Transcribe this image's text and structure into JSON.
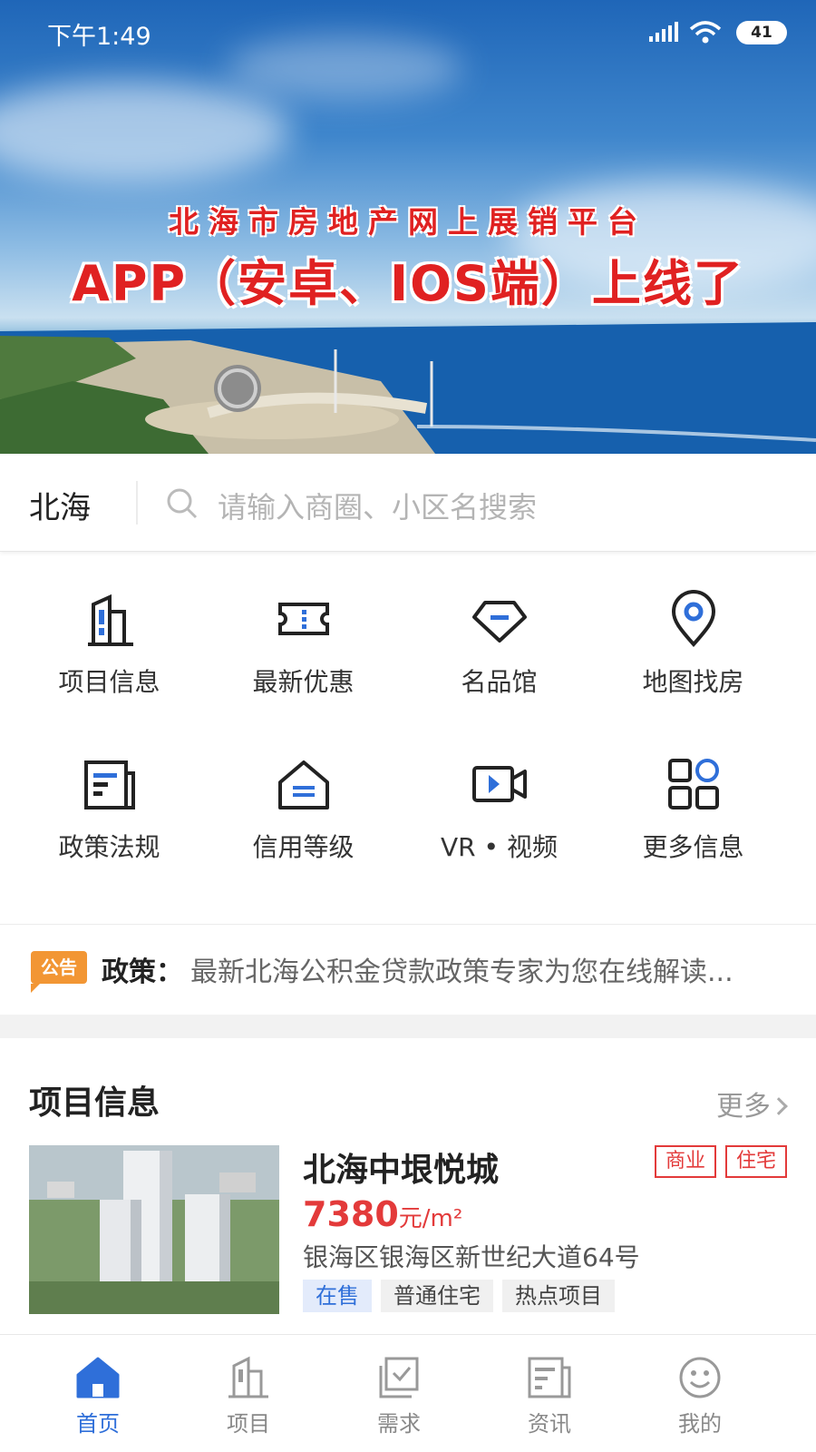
{
  "status_bar": {
    "time": "下午1:49",
    "battery": "41"
  },
  "banner": {
    "title_line1": "北海市房地产网上展销平台",
    "title_line2": "APP（安卓、IOS端）上线了"
  },
  "search": {
    "city": "北海",
    "placeholder": "请输入商圈、小区名搜索"
  },
  "menu": [
    {
      "label": "项目信息",
      "icon": "building-icon"
    },
    {
      "label": "最新优惠",
      "icon": "ticket-icon"
    },
    {
      "label": "名品馆",
      "icon": "diamond-icon"
    },
    {
      "label": "地图找房",
      "icon": "map-pin-icon"
    },
    {
      "label": "政策法规",
      "icon": "document-icon"
    },
    {
      "label": "信用等级",
      "icon": "house-icon"
    },
    {
      "label": "VR • 视频",
      "icon": "video-icon"
    },
    {
      "label": "更多信息",
      "icon": "grid-icon"
    }
  ],
  "notice": {
    "tag": "公告",
    "keyword": "政策：",
    "text": "最新北海公积金贷款政策专家为您在线解读..."
  },
  "projects_section": {
    "title": "项目信息",
    "more": "更多"
  },
  "project": {
    "name": "北海中垠悦城",
    "badges": [
      "商业",
      "住宅"
    ],
    "price": "7380",
    "price_unit": "元/m²",
    "address": "银海区银海区新世纪大道64号",
    "tags": [
      "在售",
      "普通住宅",
      "热点项目"
    ]
  },
  "tabbar": [
    {
      "label": "首页",
      "icon": "home-icon",
      "active": true
    },
    {
      "label": "项目",
      "icon": "building-icon",
      "active": false
    },
    {
      "label": "需求",
      "icon": "checklist-icon",
      "active": false
    },
    {
      "label": "资讯",
      "icon": "news-icon",
      "active": false
    },
    {
      "label": "我的",
      "icon": "smiley-icon",
      "active": false
    }
  ],
  "colors": {
    "accent": "#2f6fd9",
    "price": "#e33a3a",
    "notice_tag": "#f29634"
  }
}
